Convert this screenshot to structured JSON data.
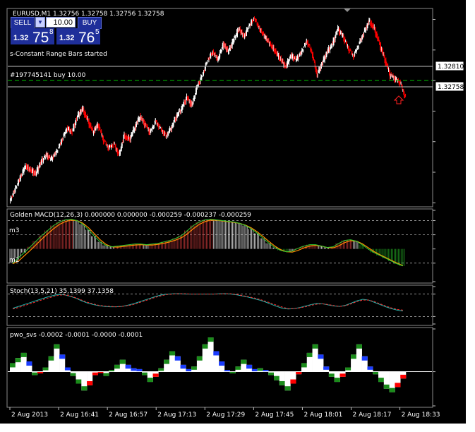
{
  "header": {
    "symbol_title": "EURUSD,M1  1.32756  1.32758  1.32756  1.32758",
    "status_text": "s-Constant Range Bars started",
    "order_text": "#197745141 buy 10.00"
  },
  "oneclick": {
    "sell_label": "SELL",
    "buy_label": "BUY",
    "lot_value": "10.00",
    "bid_small": "1.32",
    "bid_big": "75",
    "bid_sup": "8",
    "ask_small": "1.32",
    "ask_big": "76",
    "ask_sup": "5"
  },
  "colors": {
    "background": "#000000",
    "bull": "#ffffff",
    "bear": "#ff0000",
    "grid": "#c0c0c0",
    "order_line": "#00c000",
    "stoch_main": "#20b2aa",
    "stoch_signal": "#ff3030",
    "macd_signal": "#ff8c00",
    "macd_main": "#32cd32",
    "pwo_green": "#1a8c1a",
    "pwo_blue": "#1a3cff",
    "pwo_red": "#ff0000"
  },
  "chart_data": [
    {
      "type": "candlestick",
      "title": "EURUSD,M1",
      "ylim": [
        1.3245,
        1.3296
      ],
      "yticks": [
        "1.32935",
        "1.32855",
        "1.32775",
        "1.32695",
        "1.32615",
        "1.32535",
        "1.32455"
      ],
      "price_labels": {
        "current": "1.32758",
        "order": "1.32810"
      },
      "close_series": [
        1.3249,
        1.3252,
        1.3255,
        1.3254,
        1.3253,
        1.3256,
        1.3258,
        1.3257,
        1.3259,
        1.3262,
        1.3265,
        1.3264,
        1.3268,
        1.327,
        1.3267,
        1.3264,
        1.3266,
        1.3262,
        1.326,
        1.3261,
        1.3258,
        1.3263,
        1.3262,
        1.3265,
        1.3268,
        1.3266,
        1.3264,
        1.3267,
        1.3265,
        1.3263,
        1.3265,
        1.3268,
        1.327,
        1.3273,
        1.3271,
        1.3276,
        1.3279,
        1.3283,
        1.3285,
        1.3283,
        1.3287,
        1.3285,
        1.3288,
        1.3291,
        1.3289,
        1.3292,
        1.3294,
        1.3291,
        1.3289,
        1.3287,
        1.3285,
        1.3283,
        1.3281,
        1.3284,
        1.3283,
        1.3285,
        1.3288,
        1.3285,
        1.3279,
        1.3282,
        1.3285,
        1.3287,
        1.3291,
        1.3289,
        1.3286,
        1.3284,
        1.3287,
        1.329,
        1.3293,
        1.3291,
        1.3287,
        1.3283,
        1.3279,
        1.3278,
        1.3277,
        1.3273
      ],
      "order_level": 1.3281,
      "current_level": 1.32758,
      "xticks": [
        "2 Aug 2013",
        "2 Aug 16:41",
        "2 Aug 16:57",
        "2 Aug 17:13",
        "2 Aug 17:29",
        "2 Aug 17:45",
        "2 Aug 18:01",
        "2 Aug 18:17",
        "2 Aug 18:33"
      ]
    },
    {
      "type": "histogram_line",
      "title": "Golden MACD(12,26,3) 0.000000 0.000000 -0.000259 -0.000237 -0.000259",
      "ylim": [
        -0.000461,
        0.000544
      ],
      "yticks": [
        "0.000544",
        "0.0004",
        "0.0002",
        "0.00",
        "-0.0002",
        "-0.000461"
      ],
      "left_labels": [
        "m3",
        "m2"
      ],
      "values": [
        -0.0002,
        -0.00012,
        -5e-05,
        3e-05,
        0.00011,
        0.00019,
        0.00026,
        0.00033,
        0.00038,
        0.00041,
        0.00042,
        0.0004,
        0.00035,
        0.00027,
        0.00018,
        0.0001,
        5e-05,
        3e-05,
        4e-05,
        5e-05,
        6e-05,
        7e-05,
        7e-05,
        6e-05,
        7e-05,
        8e-05,
        0.0001,
        0.00012,
        0.00015,
        0.00019,
        0.00026,
        0.00033,
        0.00038,
        0.00041,
        0.00042,
        0.00041,
        0.0004,
        0.00039,
        0.00038,
        0.00036,
        0.00033,
        0.00028,
        0.00022,
        0.00015,
        8e-05,
        2e-05,
        -2e-05,
        -4e-05,
        -3e-05,
        1e-05,
        4e-05,
        6e-05,
        6e-05,
        4e-05,
        2e-05,
        3e-05,
        8e-05,
        0.00012,
        0.00013,
        0.00011,
        6e-05,
        0.0,
        -5e-05,
        -9e-05,
        -0.00013,
        -0.00017,
        -0.00021,
        -0.00024
      ]
    },
    {
      "type": "line",
      "title": "Stoch(13,5,21) 35.1399 37.1358",
      "ylim": [
        0,
        100
      ],
      "yticks": [
        "100",
        "80",
        "20",
        "0"
      ],
      "series": [
        {
          "values": [
            42,
            47,
            52,
            57,
            62,
            67,
            72,
            76,
            79,
            78,
            74,
            69,
            62,
            56,
            52,
            49,
            47,
            46,
            46,
            47,
            50,
            54,
            59,
            64,
            69,
            74,
            78,
            80,
            81,
            81,
            80,
            80,
            80,
            80,
            80,
            80,
            81,
            81,
            80,
            78,
            75,
            72,
            68,
            64,
            59,
            53,
            47,
            42,
            40,
            41,
            44,
            48,
            52,
            55,
            54,
            51,
            48,
            47,
            50,
            56,
            62,
            66,
            64,
            58,
            52,
            46,
            41,
            37,
            35
          ]
        },
        {
          "values": [
            40,
            44,
            49,
            54,
            59,
            64,
            69,
            73,
            77,
            78,
            75,
            70,
            64,
            58,
            54,
            50,
            48,
            47,
            46,
            47,
            49,
            52,
            57,
            62,
            67,
            72,
            76,
            79,
            80,
            81,
            81,
            80,
            80,
            80,
            80,
            80,
            80,
            81,
            81,
            79,
            76,
            73,
            70,
            66,
            61,
            56,
            50,
            45,
            41,
            41,
            43,
            46,
            50,
            53,
            54,
            52,
            49,
            47,
            49,
            54,
            60,
            64,
            64,
            60,
            54,
            48,
            43,
            39,
            37
          ]
        }
      ]
    },
    {
      "type": "bar",
      "title": "pwo_svs -0.0002 -0.0001 -0.0000 -0.0001",
      "ylim": [
        -0.0004,
        0.0005
      ],
      "yticks": [
        "0.0005",
        "0.00",
        "-0.0004"
      ],
      "values": [
        0.0001,
        0.00016,
        0.00022,
        0.00012,
        -4e-05,
        -2e-05,
        5e-05,
        0.00018,
        0.00032,
        0.0002,
        5e-05,
        -5e-05,
        -0.00014,
        -0.00022,
        -0.00016,
        -4e-05,
        0.0,
        -5e-05,
        2e-05,
        8e-05,
        0.00014,
        8e-05,
        4e-05,
        3e-05,
        -4e-05,
        -0.00012,
        -6e-05,
        4e-05,
        0.00014,
        0.00024,
        0.00018,
        8e-05,
        3e-05,
        6e-05,
        0.00018,
        0.00032,
        0.0004,
        0.00024,
        0.00012,
        2e-05,
        -2e-05,
        6e-05,
        0.00014,
        8e-05,
        3e-05,
        4e-05,
        2e-05,
        -4e-05,
        -0.0001,
        -0.00016,
        -0.00022,
        -0.00014,
        -3e-05,
        0.0001,
        0.00022,
        0.00032,
        0.0002,
        6e-05,
        -6e-05,
        -0.00012,
        -6e-05,
        5e-05,
        0.0002,
        0.00032,
        0.00018,
        6e-05,
        -3e-05,
        -0.00012,
        -0.0002,
        -0.00024,
        -0.00018,
        -8e-05
      ]
    }
  ]
}
